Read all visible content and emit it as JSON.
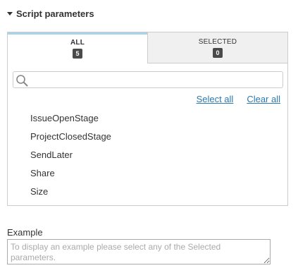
{
  "section": {
    "title": "Script parameters",
    "caret_icon": "caret-down-icon"
  },
  "tabs": [
    {
      "label": "ALL",
      "count": "5",
      "active": true
    },
    {
      "label": "SELECTED",
      "count": "0",
      "active": false
    }
  ],
  "search": {
    "icon": "search-icon",
    "value": "",
    "placeholder": ""
  },
  "links": {
    "select_all": "Select all",
    "clear_all": "Clear all"
  },
  "parameters": [
    "IssueOpenStage",
    "ProjectClosedStage",
    "SendLater",
    "Share",
    "Size"
  ],
  "example": {
    "label": "Example",
    "placeholder": "To display an example please select any of the Selected parameters."
  },
  "colors": {
    "link": "#2a7ab0",
    "active_tab_border": "#a9d3ea",
    "badge_bg": "#4a4a4a",
    "inactive_tab_bg": "#f0f0f0"
  }
}
